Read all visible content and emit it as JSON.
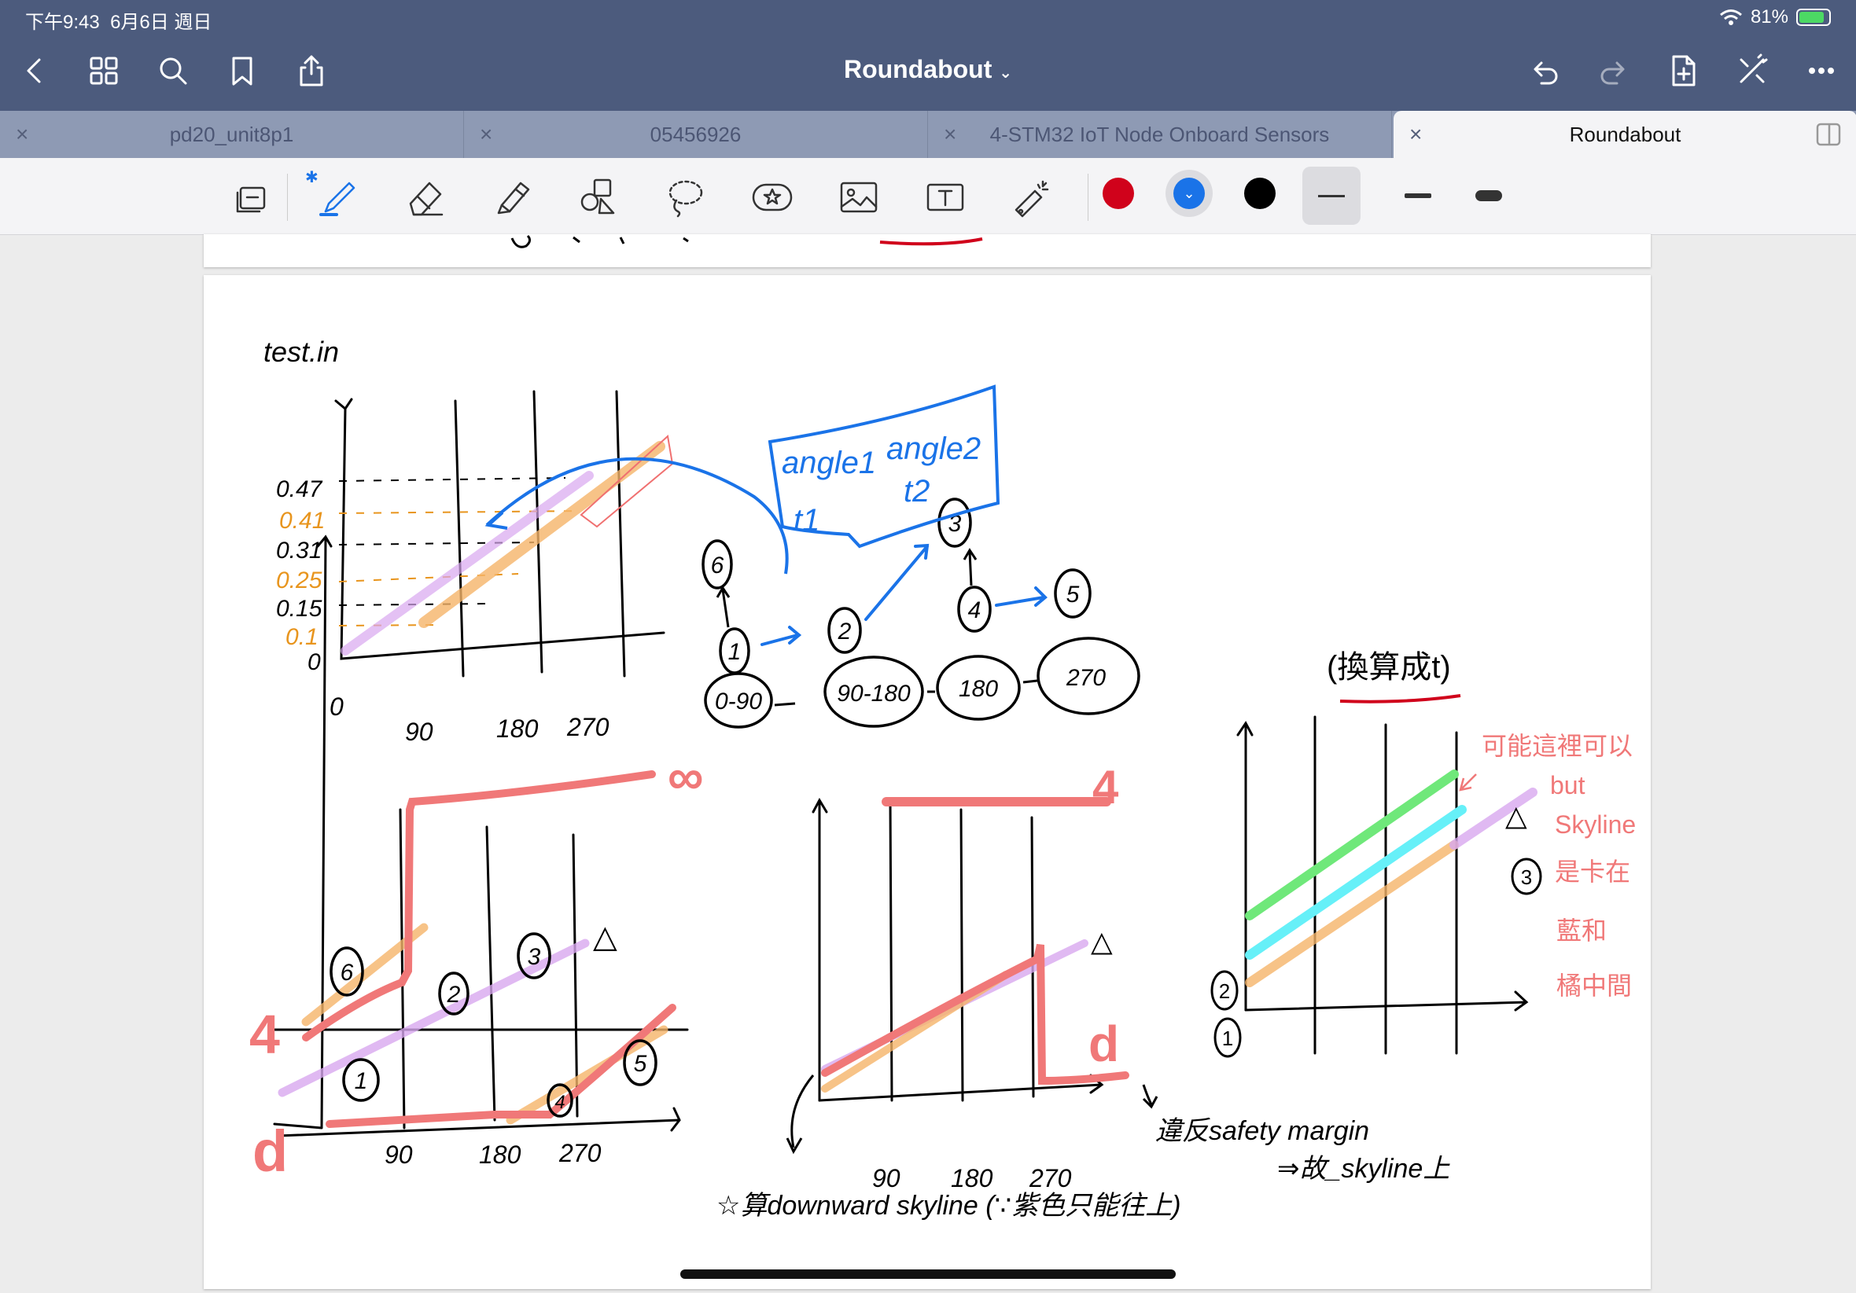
{
  "status": {
    "time": "下午9:43",
    "date": "6月6日 週日",
    "battery": "81%"
  },
  "header": {
    "title": "Roundabout"
  },
  "tabs": [
    {
      "label": "pd20_unit8p1"
    },
    {
      "label": "05456926"
    },
    {
      "label": "4-STM32 IoT Node Onboard Sensors"
    },
    {
      "label": "Roundabout",
      "active": true
    }
  ],
  "colors": {
    "red": "#d0021b",
    "blue": "#1a73e8",
    "black": "#000000"
  },
  "note": {
    "title": "test.in",
    "y_ticks": [
      "0.47",
      "0.41",
      "0.31",
      "0.25",
      "0.15",
      "0.1",
      "0"
    ],
    "x_ticks": [
      "0",
      "90",
      "180",
      "270"
    ],
    "nodes": [
      "1",
      "2",
      "3",
      "4",
      "5",
      "6"
    ],
    "segments": [
      "0-90",
      "90-180",
      "180",
      "270"
    ],
    "box": [
      "angle1",
      "angle2",
      "t1",
      "t2"
    ],
    "convert": "(換算成t)",
    "side": [
      "可能這裡可以",
      "but",
      "Skyline",
      "是卡在",
      "藍和",
      "橘中間"
    ],
    "marks": [
      "∞",
      "4",
      "d",
      "△",
      "②",
      "①",
      "③"
    ],
    "bottom_ticks": [
      "90",
      "180",
      "270"
    ],
    "mid_ticks": [
      "90",
      "180",
      "270"
    ],
    "violate": "違反safety margin",
    "thus": "⇒故_skyline上",
    "bottom": "☆算downward skyline (∵紫色只能往上)"
  }
}
